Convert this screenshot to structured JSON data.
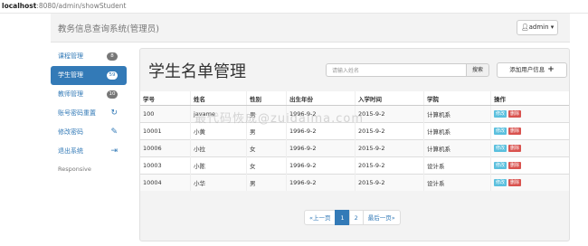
{
  "browser": {
    "host": "localhost",
    "path": ":8080/admin/showStudent"
  },
  "header": {
    "brand": "教务信息查询系统(管理员)",
    "user_icon": "user-icon",
    "user_label": "admin",
    "caret": "▾"
  },
  "sidebar": {
    "items": [
      {
        "label": "课程管理",
        "badge": "8",
        "active": false
      },
      {
        "label": "学生管理",
        "badge": "59",
        "active": true
      },
      {
        "label": "教师管理",
        "badge": "10",
        "active": false
      },
      {
        "label": "账号密码重置",
        "icon": "refresh-icon",
        "glyph": "↻"
      },
      {
        "label": "修改密码",
        "icon": "pencil-icon",
        "glyph": "✎"
      },
      {
        "label": "退出系统",
        "icon": "logout-icon",
        "glyph": "⇥"
      }
    ],
    "footer": "Responsive"
  },
  "main": {
    "title": "学生名单管理",
    "search_placeholder": "请输入姓名",
    "search_button": "搜索",
    "add_button": "添加用户信息",
    "columns": [
      "学号",
      "姓名",
      "性别",
      "出生年份",
      "入学时间",
      "学院",
      "操作"
    ],
    "rows": [
      {
        "id": "100",
        "name": "javame",
        "gender": "男",
        "birth": "1996-9-2",
        "enroll": "2015-9-2",
        "college": "计算机系"
      },
      {
        "id": "10001",
        "name": "小黄",
        "gender": "男",
        "birth": "1996-9-2",
        "enroll": "2015-9-2",
        "college": "计算机系"
      },
      {
        "id": "10006",
        "name": "小拉",
        "gender": "女",
        "birth": "1996-9-2",
        "enroll": "2015-9-2",
        "college": "计算机系"
      },
      {
        "id": "10003",
        "name": "小陈",
        "gender": "女",
        "birth": "1996-9-2",
        "enroll": "2015-9-2",
        "college": "设计系"
      },
      {
        "id": "10004",
        "name": "小华",
        "gender": "男",
        "birth": "1996-9-2",
        "enroll": "2015-9-2",
        "college": "设计系"
      }
    ],
    "edit_label": "修改",
    "delete_label": "删除",
    "pagination": {
      "prev": "«上一页",
      "pages": [
        "1",
        "2"
      ],
      "current": "1",
      "next": "最后一页»"
    }
  },
  "watermark": "最代码恢成@zuidaima.com",
  "colors": {
    "primary": "#337ab7",
    "info": "#5bc0de",
    "danger": "#d9534f",
    "badge": "#777777"
  }
}
